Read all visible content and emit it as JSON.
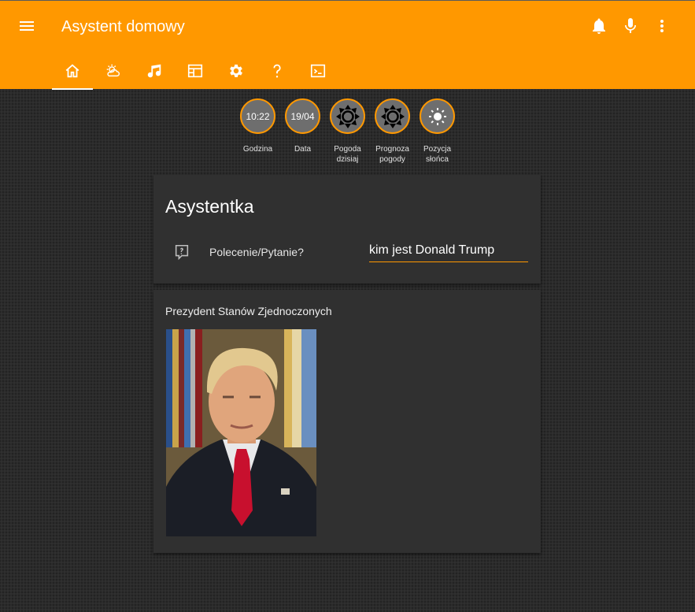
{
  "app": {
    "title": "Asystent domowy",
    "accent_color": "#ff9800",
    "icons": {
      "menu": "menu-icon",
      "notifications": "bell-icon",
      "voice": "microphone-icon",
      "more": "more-vert-icon"
    }
  },
  "tabs": [
    {
      "icon": "home-icon",
      "active": true
    },
    {
      "icon": "weather-partly-cloudy-icon",
      "active": false
    },
    {
      "icon": "music-note-icon",
      "active": false
    },
    {
      "icon": "calendar-table-icon",
      "active": false
    },
    {
      "icon": "gear-icon",
      "active": false
    },
    {
      "icon": "help-icon",
      "active": false
    },
    {
      "icon": "console-icon",
      "active": false
    }
  ],
  "badges": [
    {
      "value": "10:22",
      "label": "Godzina"
    },
    {
      "value": "19/04",
      "label": "Data"
    },
    {
      "icon": "sun-moon-icon",
      "label": "Pogoda dzisiaj"
    },
    {
      "icon": "sun-moon-icon",
      "label": "Prognoza pogody"
    },
    {
      "icon": "sun-icon",
      "label": "Pozycja słońca"
    }
  ],
  "assistant_card": {
    "title": "Asystentka",
    "field_icon": "comment-question-icon",
    "field_label": "Polecenie/Pytanie?",
    "field_value": "kim jest Donald Trump"
  },
  "answer_card": {
    "text": "Prezydent Stanów Zjednoczonych",
    "image": "portrait-photo"
  }
}
